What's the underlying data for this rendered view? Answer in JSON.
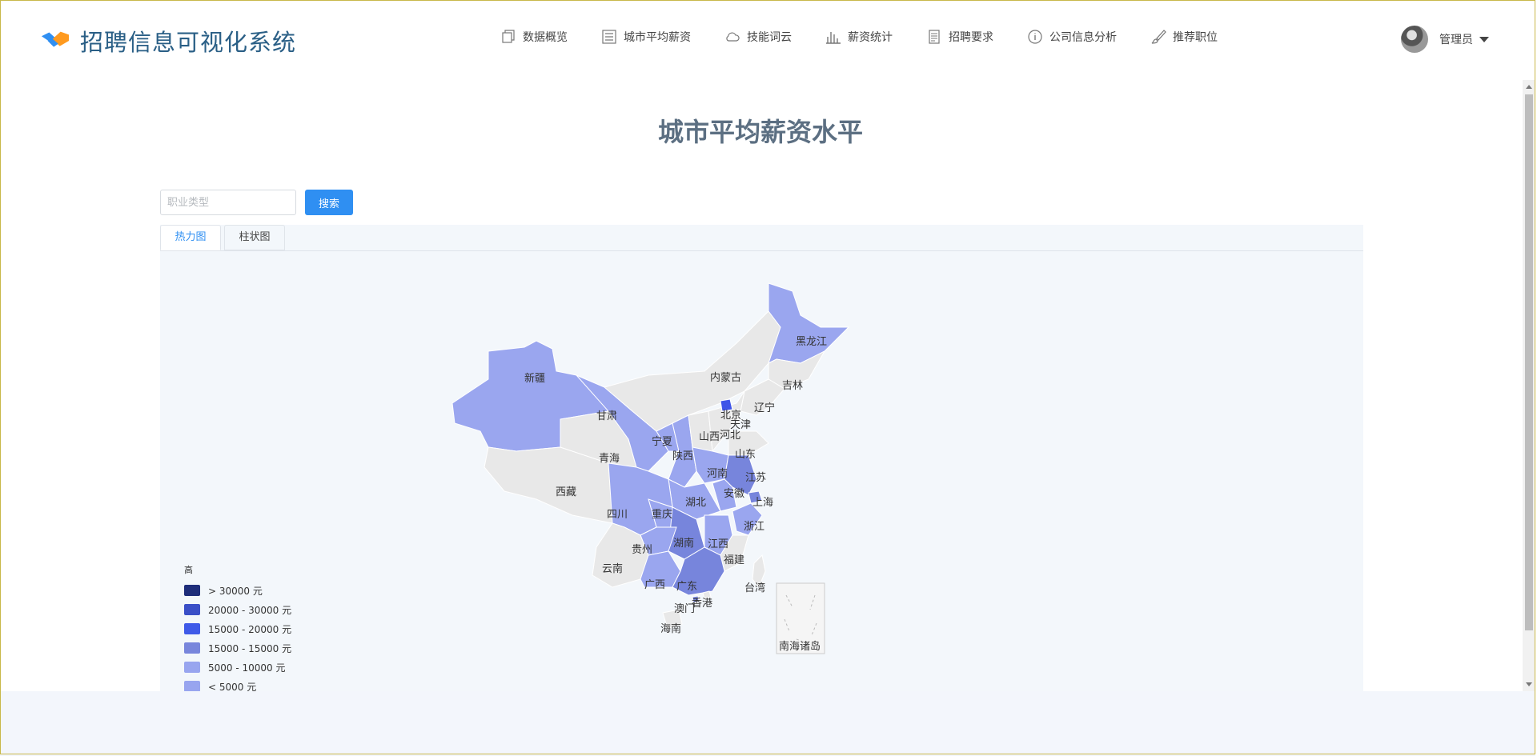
{
  "app": {
    "title": "招聘信息可视化系统"
  },
  "nav": {
    "items": [
      {
        "label": "数据概览",
        "icon": "copy-icon"
      },
      {
        "label": "城市平均薪资",
        "icon": "list-icon"
      },
      {
        "label": "技能词云",
        "icon": "cloud-icon"
      },
      {
        "label": "薪资统计",
        "icon": "bar-chart-icon"
      },
      {
        "label": "招聘要求",
        "icon": "document-icon"
      },
      {
        "label": "公司信息分析",
        "icon": "info-icon"
      },
      {
        "label": "推荐职位",
        "icon": "brush-icon"
      }
    ]
  },
  "user": {
    "name": "管理员"
  },
  "page": {
    "title": "城市平均薪资水平"
  },
  "search": {
    "placeholder": "职业类型",
    "value": "",
    "button": "搜索"
  },
  "tabs": [
    {
      "label": "热力图",
      "active": true
    },
    {
      "label": "柱状图",
      "active": false
    }
  ],
  "legend": {
    "title": "高",
    "items": [
      {
        "label": "> 30000 元",
        "color": "#1e2d7a"
      },
      {
        "label": "20000 - 30000 元",
        "color": "#3a4fc7"
      },
      {
        "label": "15000 - 20000 元",
        "color": "#3f5ae8"
      },
      {
        "label": "15000 - 15000 元",
        "color": "#7886dc"
      },
      {
        "label": "5000 - 10000 元",
        "color": "#98a5ef"
      },
      {
        "label": "< 5000 元",
        "color": "#98a5ef"
      }
    ]
  },
  "colors": {
    "none": "#e8e8e8",
    "low": "#9aa6ef",
    "mid": "#7785dc",
    "high": "#3f55e8",
    "border": "#ffffff"
  },
  "map": {
    "regions": [
      {
        "label": "新疆",
        "level": "low"
      },
      {
        "label": "西藏",
        "level": "none"
      },
      {
        "label": "青海",
        "level": "none"
      },
      {
        "label": "甘肃",
        "level": "low"
      },
      {
        "label": "内蒙古",
        "level": "none"
      },
      {
        "label": "黑龙江",
        "level": "low"
      },
      {
        "label": "吉林",
        "level": "none"
      },
      {
        "label": "辽宁",
        "level": "none"
      },
      {
        "label": "宁夏",
        "level": "low"
      },
      {
        "label": "陕西",
        "level": "low"
      },
      {
        "label": "山西",
        "level": "none"
      },
      {
        "label": "河北",
        "level": "none"
      },
      {
        "label": "北京",
        "level": "high"
      },
      {
        "label": "天津",
        "level": "none"
      },
      {
        "label": "山东",
        "level": "none"
      },
      {
        "label": "河南",
        "level": "low"
      },
      {
        "label": "江苏",
        "level": "mid"
      },
      {
        "label": "安徽",
        "level": "low"
      },
      {
        "label": "上海",
        "level": "mid"
      },
      {
        "label": "湖北",
        "level": "low"
      },
      {
        "label": "重庆",
        "level": "low"
      },
      {
        "label": "四川",
        "level": "low"
      },
      {
        "label": "浙江",
        "level": "low"
      },
      {
        "label": "湖南",
        "level": "mid"
      },
      {
        "label": "江西",
        "level": "low"
      },
      {
        "label": "贵州",
        "level": "low"
      },
      {
        "label": "云南",
        "level": "none"
      },
      {
        "label": "福建",
        "level": "none"
      },
      {
        "label": "广西",
        "level": "low"
      },
      {
        "label": "广东",
        "level": "mid"
      },
      {
        "label": "香港",
        "level": "none"
      },
      {
        "label": "澳门",
        "level": "mid"
      },
      {
        "label": "台湾",
        "level": "none"
      },
      {
        "label": "海南",
        "level": "none"
      }
    ],
    "inset_label": "南海诸岛"
  }
}
